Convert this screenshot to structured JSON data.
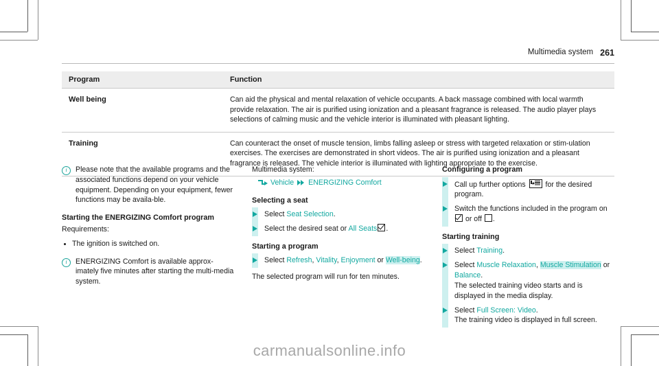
{
  "header": {
    "title": "Multimedia system",
    "page_number": "261"
  },
  "table": {
    "columns": [
      "Program",
      "Function"
    ],
    "rows": [
      {
        "program": "Well being",
        "function": "Can aid the physical and mental relaxation of vehicle occupants. A back massage combined with local warmth provide relaxation. The air is purified using ionization and a pleasant fragrance is released. The audio player plays selections of calming music and the vehicle interior is illuminated with pleasant lighting."
      },
      {
        "program": "Training",
        "function": "Can counteract the onset of muscle tension, limbs falling asleep or stress with targeted relaxation or stim‐ulation exercises. The exercises are demonstrated in short videos. The air is purified using ionization and a pleasant fragrance is released. The vehicle interior is illuminated with lighting appropriate to the exercise."
      }
    ]
  },
  "left_column": {
    "note_1": "Please note that the available programs and the associated functions depend on your vehicle equipment. Depending on your equipment, fewer functions may be availa‐ble.",
    "heading_start": "Starting the ENERGIZING Comfort program",
    "requirements_label": "Requirements:",
    "requirement_1": "The ignition is switched on.",
    "note_2": "ENERGIZING Comfort is available approx‐imately five minutes after starting the multi‐media system."
  },
  "middle_column": {
    "nav_intro": "Multimedia system:",
    "nav_path": {
      "step_1": "Vehicle",
      "step_2": "ENERGIZING Comfort"
    },
    "heading_seat": "Selecting a seat",
    "step_seat_1_pre": "Select ",
    "step_seat_1_menu": "Seat Selection",
    "step_seat_1_post": ".",
    "step_seat_2_pre": "Select the desired seat or ",
    "step_seat_2_menu": "All Seats",
    "step_seat_2_post": ".",
    "heading_program": "Starting a program",
    "step_program_pre": "Select ",
    "step_program_m1": "Refresh",
    "step_program_sep1": ", ",
    "step_program_m2": "Vitality",
    "step_program_sep2": ", ",
    "step_program_m3": "Enjoyment",
    "step_program_sep3": " or ",
    "step_program_m4": "Well-being",
    "step_program_post": ".",
    "footer_text": "The selected program will run for ten minutes."
  },
  "right_column": {
    "heading_configure": "Configuring a program",
    "step_cfg_1_pre": "Call up further options ",
    "step_cfg_1_post": " for the desired program.",
    "step_cfg_2_pre": "Switch the functions included in the program on ",
    "step_cfg_2_mid": " or off ",
    "step_cfg_2_post": ".",
    "heading_training": "Starting training",
    "step_tr_1_pre": "Select ",
    "step_tr_1_menu": "Training",
    "step_tr_1_post": ".",
    "step_tr_2_pre": "Select ",
    "step_tr_2_m1": "Muscle Relaxation",
    "step_tr_2_sep1": ", ",
    "step_tr_2_m2": "Muscle Stimulation",
    "step_tr_2_sep2": " or ",
    "step_tr_2_m3": "Balance",
    "step_tr_2_post": ".",
    "step_tr_2_result": "The selected training video starts and is displayed in the media display.",
    "step_tr_3_pre": "Select ",
    "step_tr_3_menu": "Full Screen: Video",
    "step_tr_3_post": ".",
    "step_tr_3_result": "The training video is displayed in full screen."
  },
  "watermark": "carmanualsonline.info",
  "icons": {
    "info": "info-circle-icon",
    "bullet": "bullet-dot-icon",
    "step": "triangle-step-icon",
    "nav_enter": "enter-arrow-icon",
    "nav_chevrons": "double-chevron-icon",
    "checkbox_on": "checkbox-checked-icon",
    "checkbox_off": "checkbox-unchecked-icon",
    "options": "options-list-icon"
  },
  "colors": {
    "accent_teal": "#12a8a0",
    "highlight_cyan": "#cdf0ef",
    "table_header_bg": "#ededed",
    "rule": "#c9c9c9"
  }
}
